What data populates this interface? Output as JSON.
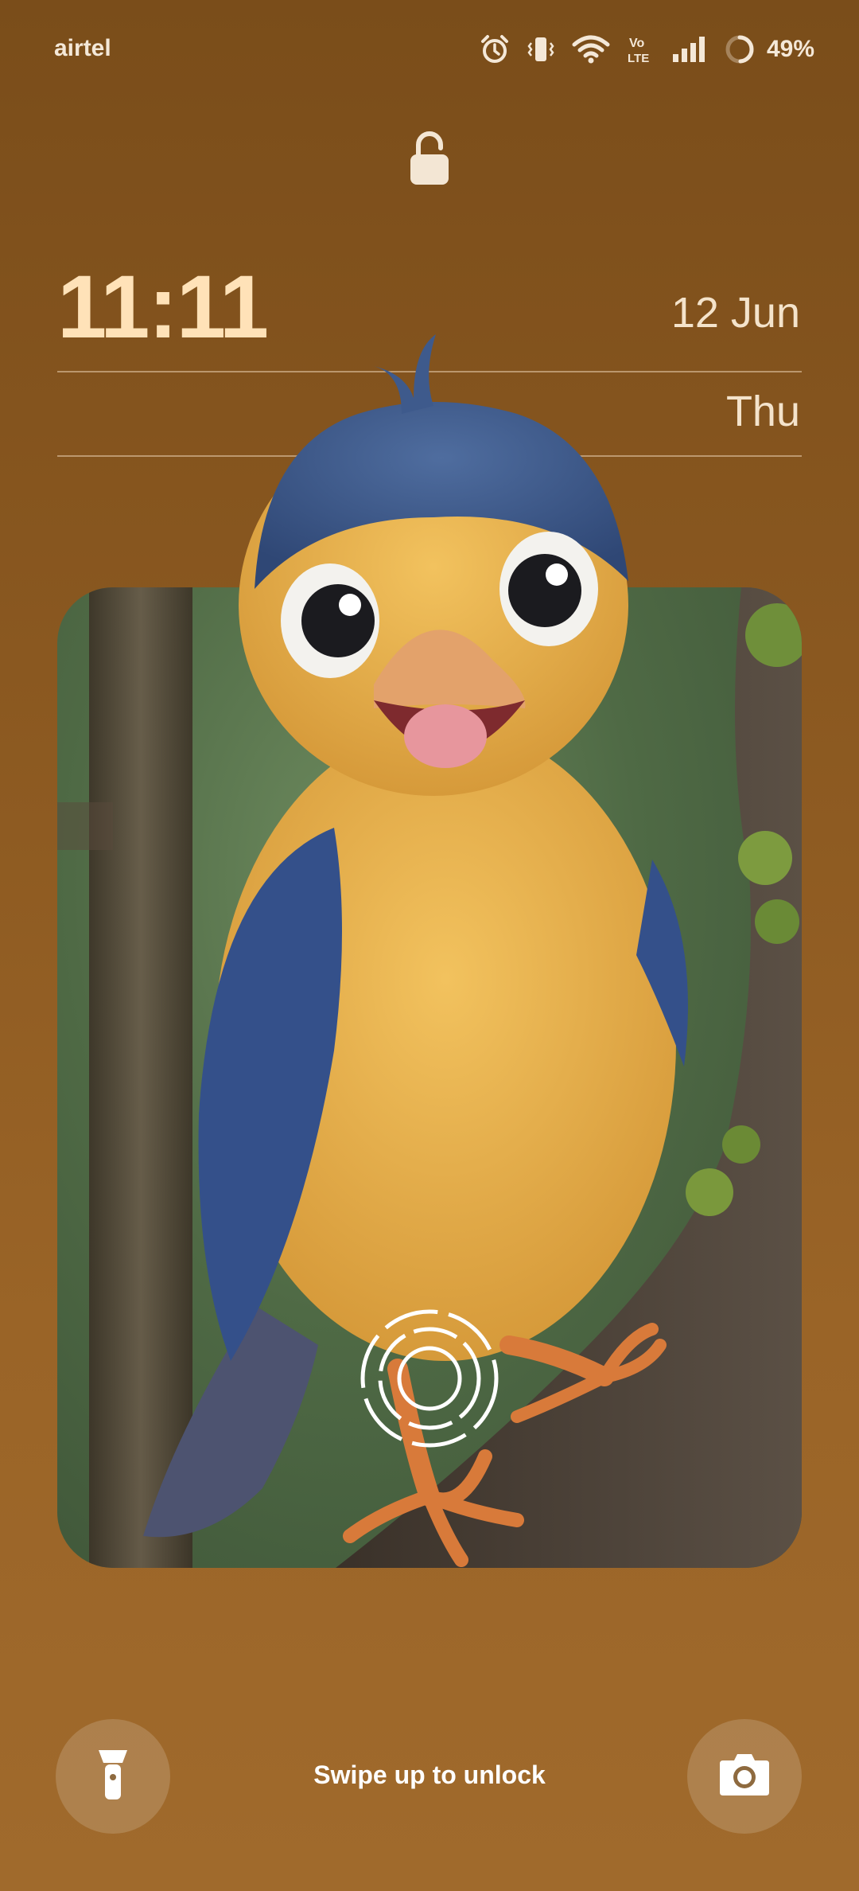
{
  "status_bar": {
    "carrier": "airtel",
    "battery_percent": "49%",
    "battery_level": 0.49,
    "network_label": "Vo LTE",
    "icons": [
      "alarm-icon",
      "vibrate-icon",
      "wifi-icon",
      "volte-icon",
      "signal-icon",
      "battery-ring-icon"
    ]
  },
  "lock": {
    "icon": "padlock-open-icon"
  },
  "clock": {
    "time": "11:11",
    "date": "12 Jun",
    "day": "Thu"
  },
  "wallpaper": {
    "subject": "cartoon-bird-on-branch"
  },
  "fingerprint": {
    "icon": "fingerprint-icon"
  },
  "bottom": {
    "left_shortcut_icon": "flashlight-icon",
    "right_shortcut_icon": "camera-icon",
    "unlock_hint": "Swipe up to unlock"
  },
  "colors": {
    "background_top": "#7a4d1a",
    "background_bottom": "#a06a2c",
    "clock_color": "#ffe2b8",
    "bird_yellow": "#e7b04a",
    "bird_blue": "#3d5a8e"
  }
}
